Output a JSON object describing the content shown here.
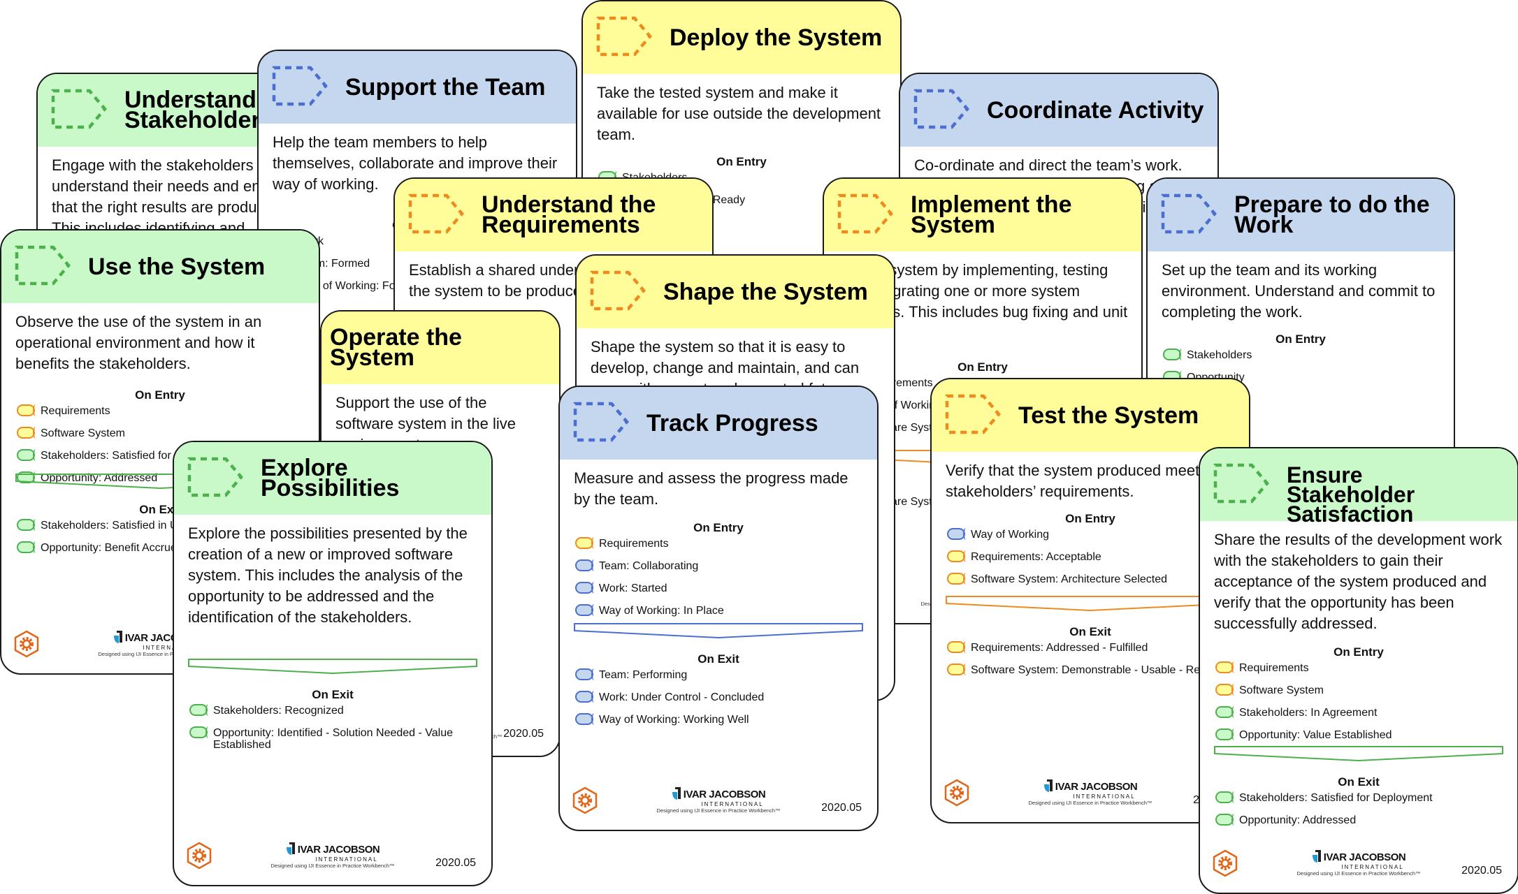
{
  "colors": {
    "green_area": "#c9f9c9",
    "blue_area": "#c5d7ef",
    "yellow_area": "#fffd99",
    "green_stroke": "#4cb04c",
    "blue_stroke": "#4a6fd0",
    "yellow_stroke": "#ef8a1e"
  },
  "common": {
    "on_entry": "On Entry",
    "on_exit": "On Exit",
    "logo_name": "IVAR JACOBSON",
    "logo_intl": "INTERNATIONAL",
    "logo_sub": "Designed using IJI Essence in Practice Workbench™",
    "version": "2020.05"
  },
  "cards": {
    "understand_stakeholder": {
      "title": "Understand Stakeholder Needs",
      "title_visible": "Understand\nStakeholder",
      "description": "Engage with the stakeholders to understand their needs and ensure that the right results are produced. This includes identifying and"
    },
    "support_team": {
      "title": "Support the Team",
      "description": "Help the team members to help themselves, collaborate and improve their way of working.",
      "entry": [
        {
          "text": "Work",
          "color": "blue"
        },
        {
          "text": "Team: Formed",
          "color": "blue"
        },
        {
          "text": "Way of Working: Foundation Established",
          "color": "blue"
        }
      ]
    },
    "deploy_system": {
      "title": "Deploy the System",
      "description": "Take the tested system and make it available for use outside the development team.",
      "entry": [
        {
          "text": "Stakeholders",
          "color": "green"
        },
        {
          "text": "Software System: Ready",
          "color": "yellow"
        }
      ]
    },
    "coordinate_activity": {
      "title": "Coordinate Activity",
      "description": "Co-ordinate and direct the team’s work. This includes all ongoing planning and re-planning of the work, and re-shaping of the team. Re-allocation of resources"
    },
    "understand_requirements": {
      "title": "Understand the Requirements",
      "description": "Establish a shared understanding of what the system to be produced must do."
    },
    "implement_system": {
      "title": "Implement the System",
      "description": "Build a system by implementing, testing and integrating one or more system elements. This includes bug fixing and unit testing.",
      "entry": [
        {
          "text": "Requirements",
          "color": "yellow"
        },
        {
          "text": "Way of Working",
          "color": "blue"
        },
        {
          "text": "Software System",
          "color": "yellow"
        }
      ],
      "exit": [
        {
          "text": "Software System: Demonstrable - Usable - Ready",
          "color": "yellow"
        }
      ]
    },
    "prepare_work": {
      "title": "Prepare to do the Work",
      "description": "Set up the team and its working environment. Understand and commit to completing the work.",
      "entry": [
        {
          "text": "Stakeholders",
          "color": "green"
        },
        {
          "text": "Opportunity",
          "color": "green"
        }
      ]
    },
    "use_system": {
      "title": "Use the System",
      "description": "Observe the use of the system in an operational environment and how it benefits the stakeholders.",
      "entry": [
        {
          "text": "Requirements",
          "color": "yellow"
        },
        {
          "text": "Software System",
          "color": "yellow"
        },
        {
          "text": "Stakeholders: Satisfied for Deployment",
          "color": "green"
        },
        {
          "text": "Opportunity: Addressed",
          "color": "green"
        }
      ],
      "exit": [
        {
          "text": "Stakeholders: Satisfied in Use",
          "color": "green"
        },
        {
          "text": "Opportunity: Benefit Accrued",
          "color": "green"
        }
      ]
    },
    "shape_system": {
      "title": "Shape the System",
      "description": "Shape the system so that it is easy to develop, change and maintain, and can cope with current and expected future demands."
    },
    "operate_system": {
      "title": "Operate the System",
      "description": "Support the use of the software system in the live environment."
    },
    "explore_possibilities": {
      "title": "Explore Possibilities",
      "description": "Explore the possibilities presented by the creation of a new or improved software system. This includes the analysis of the opportunity to be addressed and the identification of the stakeholders.",
      "exit": [
        {
          "text": "Stakeholders: Recognized",
          "color": "green"
        },
        {
          "text": "Opportunity: Identified - Solution Needed - Value Established",
          "color": "green"
        }
      ]
    },
    "track_progress": {
      "title": "Track Progress",
      "description": "Measure and assess the progress made by the team.",
      "entry": [
        {
          "text": "Requirements",
          "color": "yellow"
        },
        {
          "text": "Team: Collaborating",
          "color": "blue"
        },
        {
          "text": "Work: Started",
          "color": "blue"
        },
        {
          "text": "Way of Working: In Place",
          "color": "blue"
        }
      ],
      "exit": [
        {
          "text": "Team: Performing",
          "color": "blue"
        },
        {
          "text": "Work: Under Control - Concluded",
          "color": "blue"
        },
        {
          "text": "Way of Working: Working Well",
          "color": "blue"
        }
      ]
    },
    "test_system": {
      "title": "Test the System",
      "description": "Verify that the system produced meets the stakeholders’ requirements.",
      "entry": [
        {
          "text": "Way of Working",
          "color": "blue"
        },
        {
          "text": "Requirements: Acceptable",
          "color": "yellow"
        },
        {
          "text": "Software System: Architecture Selected",
          "color": "yellow"
        }
      ],
      "exit": [
        {
          "text": "Requirements: Addressed - Fulfilled",
          "color": "yellow"
        },
        {
          "text": "Software System: Demonstrable - Usable - Ready",
          "color": "yellow"
        }
      ]
    },
    "ensure_satisfaction": {
      "title": "Ensure Stakeholder Satisfaction",
      "description": "Share the results of the development work with the stakeholders to gain their acceptance of the system produced and verify that the opportunity has been successfully addressed.",
      "entry": [
        {
          "text": "Requirements",
          "color": "yellow"
        },
        {
          "text": "Software System",
          "color": "yellow"
        },
        {
          "text": "Stakeholders: In Agreement",
          "color": "green"
        },
        {
          "text": "Opportunity: Value Established",
          "color": "green"
        }
      ],
      "exit": [
        {
          "text": "Stakeholders: Satisfied for Deployment",
          "color": "green"
        },
        {
          "text": "Opportunity: Addressed",
          "color": "green"
        }
      ]
    }
  }
}
